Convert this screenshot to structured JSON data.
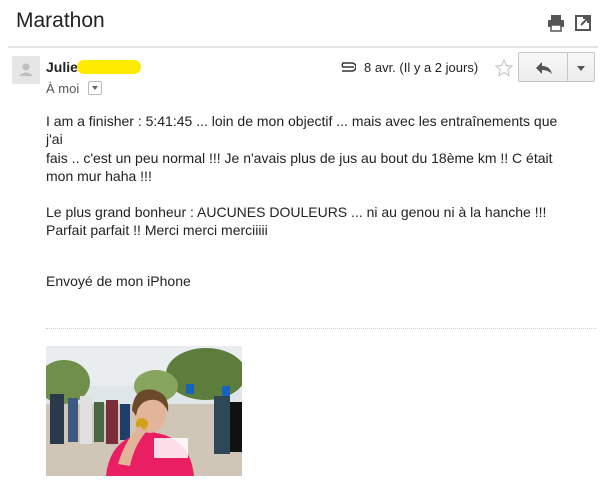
{
  "subject": "Marathon",
  "toolbar": {
    "print_icon": "printer-icon",
    "newwindow_icon": "open-in-new-window-icon"
  },
  "message": {
    "sender": "Julie",
    "recipient_label": "À moi",
    "date": "8 avr. (Il y a 2 jours)",
    "body_lines": [
      "I am a finisher : 5:41:45 ... loin de mon objectif ... mais avec les entraînements que j'ai",
      "fais .. c'est un peu normal !!! Je n'avais plus de jus au bout du 18ème km !! C était",
      "mon mur haha !!!"
    ],
    "body_lines_2": [
      "Le plus grand bonheur : AUCUNES DOULEURS ... ni au genou ni à la hanche !!!",
      "Parfait parfait !! Merci merci merciiiii"
    ],
    "signature": "Envoyé de mon iPhone"
  },
  "colors": {
    "redaction": "#ffeb00",
    "shirt": "#e91e63"
  }
}
